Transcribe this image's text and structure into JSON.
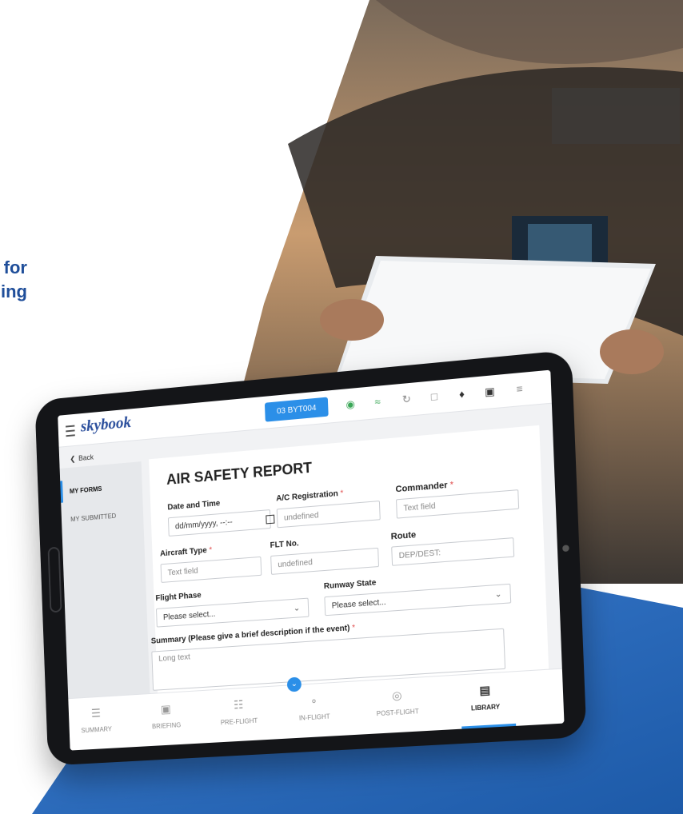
{
  "hero_text": {
    "line1": "for",
    "line2": "ning"
  },
  "app": {
    "logo": "skybook",
    "flight_button": "03 BYT004",
    "back_label": "Back",
    "sidebar": [
      {
        "label": "MY FORMS",
        "active": true
      },
      {
        "label": "MY SUBMITTED",
        "active": false
      }
    ],
    "form": {
      "title": "AIR SAFETY REPORT",
      "fields": {
        "date_time": {
          "label": "Date and Time",
          "value": "dd/mm/yyyy, --:--",
          "required": false
        },
        "ac_registration": {
          "label": "A/C Registration",
          "placeholder": "undefined",
          "required": true
        },
        "commander": {
          "label": "Commander",
          "placeholder": "Text field",
          "required": true
        },
        "aircraft_type": {
          "label": "Aircraft Type",
          "placeholder": "Text field",
          "required": true
        },
        "flt_no": {
          "label": "FLT No.",
          "placeholder": "undefined",
          "required": false
        },
        "route": {
          "label": "Route",
          "placeholder": "DEP/DEST:",
          "required": false
        },
        "flight_phase": {
          "label": "Flight Phase",
          "value": "Please select...",
          "required": false
        },
        "runway_state": {
          "label": "Runway State",
          "value": "Please select...",
          "required": false
        },
        "summary": {
          "label": "Summary (Please give a brief description if the event)",
          "placeholder": "Long text",
          "required": true
        }
      },
      "required_marker": "*"
    },
    "bottom_nav": [
      {
        "label": "SUMMARY",
        "icon": "list-icon",
        "active": false
      },
      {
        "label": "BRIEFING",
        "icon": "briefing-icon",
        "active": false
      },
      {
        "label": "PRE-FLIGHT",
        "icon": "checklist-icon",
        "active": false
      },
      {
        "label": "IN-FLIGHT",
        "icon": "route-icon",
        "active": false
      },
      {
        "label": "POST-FLIGHT",
        "icon": "location-icon",
        "active": false
      },
      {
        "label": "LIBRARY",
        "icon": "book-icon",
        "active": true
      }
    ],
    "expand_icon": "chevron-down-icon",
    "accent_color": "#2b8fe8",
    "brand_color": "#2a4e9c"
  }
}
